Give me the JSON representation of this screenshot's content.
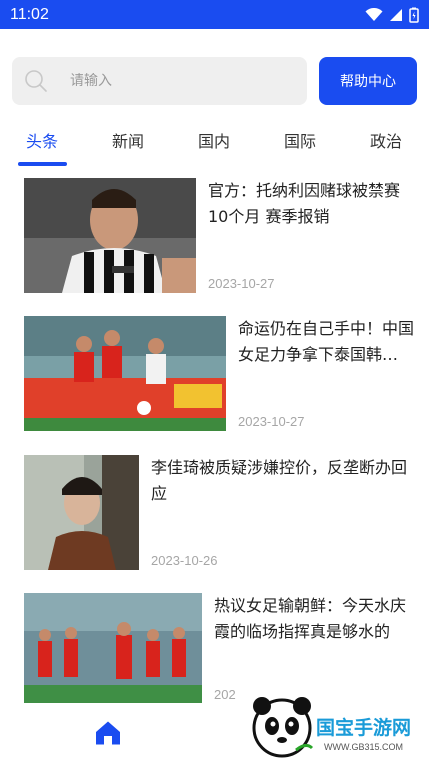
{
  "status_bar": {
    "time": "11:02"
  },
  "search": {
    "placeholder": "请输入"
  },
  "help_button": {
    "label": "帮助中心"
  },
  "tabs": [
    {
      "label": "头条",
      "active": true
    },
    {
      "label": "新闻",
      "active": false
    },
    {
      "label": "国内",
      "active": false
    },
    {
      "label": "国际",
      "active": false
    },
    {
      "label": "政治",
      "active": false
    }
  ],
  "news": [
    {
      "title": "官方：托纳利因赌球被禁赛10个月 赛季报销",
      "date": "2023-10-27"
    },
    {
      "title": "命运仍在自己手中！中国女足力争拿下泰国韩…",
      "date": "2023-10-27"
    },
    {
      "title": "李佳琦被质疑涉嫌控价，反垄断办回应",
      "date": "2023-10-26"
    },
    {
      "title": "热议女足输朝鲜：今天水庆霞的临场指挥真是够水的",
      "date": "202"
    }
  ],
  "watermark": {
    "brand": "国宝手游网",
    "url": "WWW.GB315.COM"
  },
  "colors": {
    "accent": "#1a4cf0",
    "date": "#a6a6a6"
  }
}
